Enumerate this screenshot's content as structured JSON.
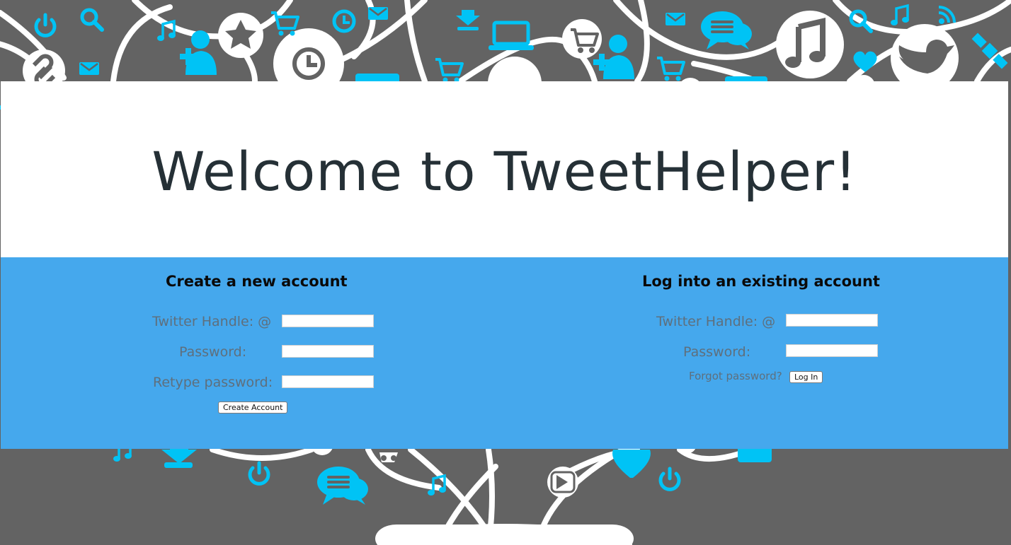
{
  "header": {
    "welcome_title": "Welcome to TweetHelper!"
  },
  "signup": {
    "title": "Create a new account",
    "handle_label": "Twitter Handle: @",
    "handle_value": "",
    "password_label": "Password:",
    "password_value": "",
    "retype_label": "Retype password:",
    "retype_value": "",
    "submit_label": "Create Account"
  },
  "login": {
    "title": "Log into an existing account",
    "handle_label": "Twitter Handle: @",
    "handle_value": "",
    "password_label": "Password:",
    "password_value": "",
    "forgot_label": "Forgot password?",
    "submit_label": "Log In"
  },
  "background": {
    "icons": [
      "power-icon",
      "search-icon",
      "music-note-icon",
      "add-user-icon",
      "star-icon",
      "clock-icon",
      "shopping-cart-icon",
      "mail-icon",
      "download-icon",
      "laptop-icon",
      "chat-bubbles-icon",
      "twitter-bird-icon",
      "heart-icon",
      "rss-icon",
      "satellite-icon",
      "link-icon",
      "play-icon"
    ]
  },
  "colors": {
    "background": "#636363",
    "icon_accent": "#00c3f5",
    "form_band": "#45a8ed",
    "header_band": "#ffffff",
    "title_text": "#253036",
    "label_text": "#5e6f7d"
  }
}
